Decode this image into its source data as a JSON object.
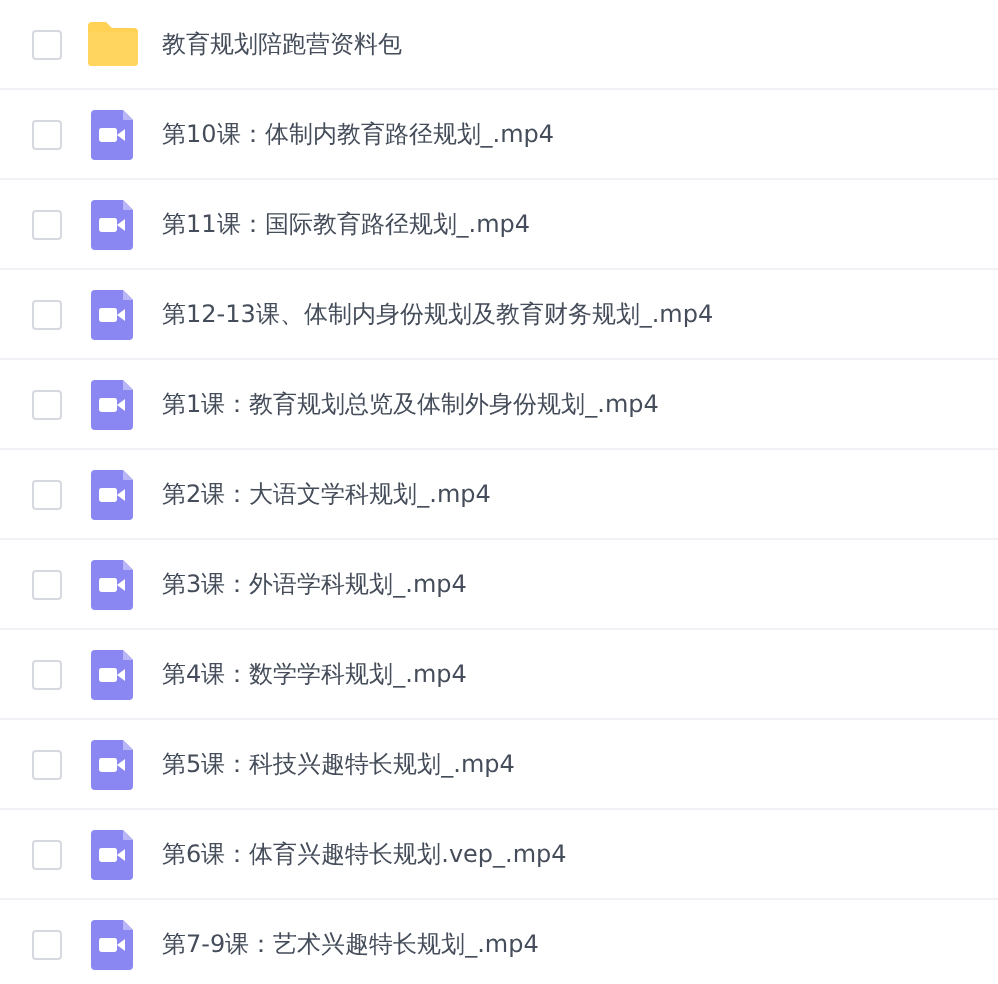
{
  "files": [
    {
      "kind": "folder",
      "name": "教育规划陪跑营资料包",
      "checked": false
    },
    {
      "kind": "video",
      "name": "第10课：体制内教育路径规划_.mp4",
      "checked": false
    },
    {
      "kind": "video",
      "name": "第11课：国际教育路径规划_.mp4",
      "checked": false
    },
    {
      "kind": "video",
      "name": "第12-13课、体制内身份规划及教育财务规划_.mp4",
      "checked": false
    },
    {
      "kind": "video",
      "name": "第1课：教育规划总览及体制外身份规划_.mp4",
      "checked": false
    },
    {
      "kind": "video",
      "name": "第2课：大语文学科规划_.mp4",
      "checked": false
    },
    {
      "kind": "video",
      "name": "第3课：外语学科规划_.mp4",
      "checked": false
    },
    {
      "kind": "video",
      "name": "第4课：数学学科规划_.mp4",
      "checked": false
    },
    {
      "kind": "video",
      "name": "第5课：科技兴趣特长规划_.mp4",
      "checked": false
    },
    {
      "kind": "video",
      "name": "第6课：体育兴趣特长规划.vep_.mp4",
      "checked": false
    },
    {
      "kind": "video",
      "name": "第7-9课：艺术兴趣特长规划_.mp4",
      "checked": false
    }
  ]
}
